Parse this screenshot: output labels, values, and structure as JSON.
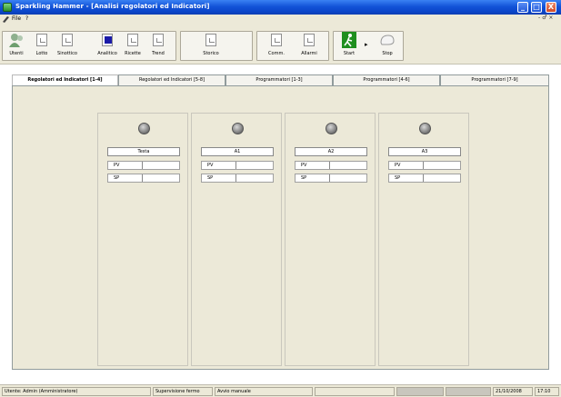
{
  "window": {
    "title": "Sparkling Hammer - [Analisi regolatori ed Indicatori]",
    "controls": [
      "_",
      "□",
      "X"
    ]
  },
  "menubar": {
    "items": [
      "File",
      "?"
    ],
    "mdi_controls": "- ♂ ×"
  },
  "toolbar": {
    "buttons": [
      {
        "label": "Utenti",
        "icon": "users-icon"
      },
      {
        "label": "Lotto",
        "icon": "document-icon"
      },
      {
        "label": "Sinottico",
        "icon": "document-icon"
      },
      {
        "label": "Analitico",
        "icon": "analog-icon"
      },
      {
        "label": "Ricette",
        "icon": "document-icon"
      },
      {
        "label": "Trend",
        "icon": "document-icon"
      },
      {
        "label": "Storico",
        "icon": "document-icon"
      },
      {
        "label": "Comm.",
        "icon": "document-icon"
      },
      {
        "label": "Allarmi",
        "icon": "document-icon"
      },
      {
        "label": "Start",
        "icon": "start-icon"
      },
      {
        "label": "Stop",
        "icon": "stop-icon"
      }
    ]
  },
  "tabs": [
    {
      "label": "Regolatori ed Indicatori [1-4]",
      "active": true
    },
    {
      "label": "Regolatori ed Indicatori [5-8]",
      "active": false
    },
    {
      "label": "Programmatori [1-3]",
      "active": false
    },
    {
      "label": "Programmatori [4-6]",
      "active": false
    },
    {
      "label": "Programmatori [7-9]",
      "active": false
    }
  ],
  "regulators": [
    {
      "name": "Testa",
      "pv_label": "PV",
      "pv_value": "",
      "sp_label": "SP",
      "sp_value": ""
    },
    {
      "name": "A1",
      "pv_label": "PV",
      "pv_value": "",
      "sp_label": "SP",
      "sp_value": ""
    },
    {
      "name": "A2",
      "pv_label": "PV",
      "pv_value": "",
      "sp_label": "SP",
      "sp_value": ""
    },
    {
      "name": "A3",
      "pv_label": "PV",
      "pv_value": "",
      "sp_label": "SP",
      "sp_value": ""
    }
  ],
  "statusbar": {
    "user": "Utente: Admin (Amministratore)",
    "supervision": "Supervisione fermo",
    "mode": "Avvio manuale",
    "empty": "",
    "date": "21/10/2008",
    "time": "17:10"
  },
  "colors": {
    "titlebar": "#0a45c9",
    "window_bg": "#ece9d8"
  }
}
